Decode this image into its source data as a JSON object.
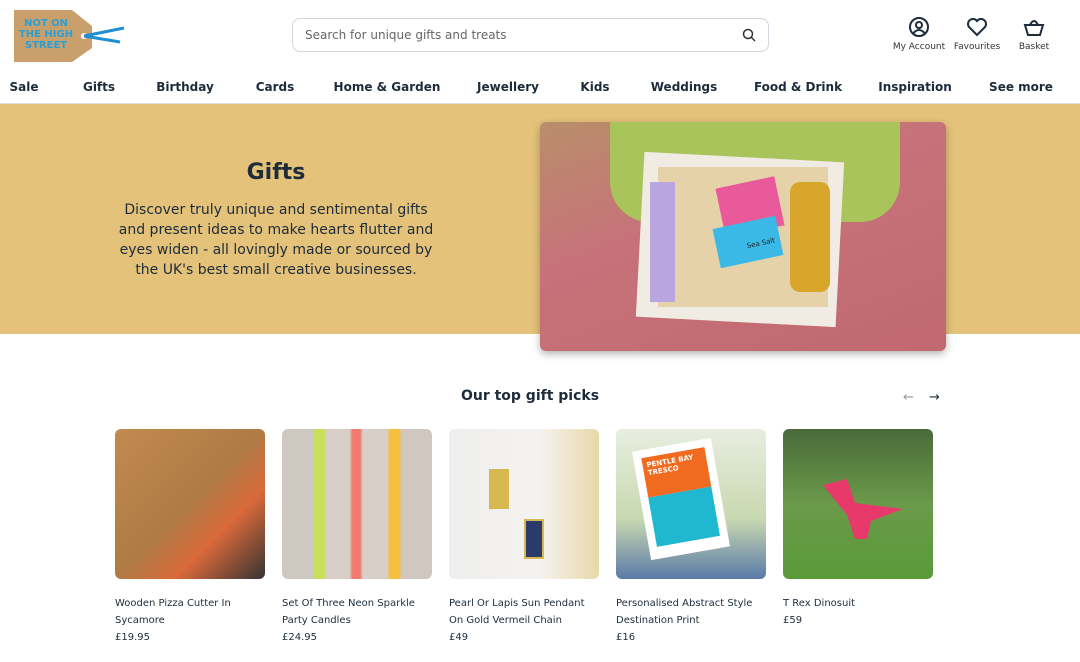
{
  "header": {
    "logo_text": "NOT ON THE HIGH STREET",
    "search_placeholder": "Search for unique gifts and treats",
    "icons": [
      {
        "label": "My Account",
        "icon": "account-icon"
      },
      {
        "label": "Favourites",
        "icon": "heart-icon"
      },
      {
        "label": "Basket",
        "icon": "basket-icon"
      }
    ]
  },
  "nav": [
    "Sale",
    "Gifts",
    "Birthday",
    "Cards",
    "Home & Garden",
    "Jewellery",
    "Kids",
    "Weddings",
    "Food & Drink",
    "Inspiration",
    "See more"
  ],
  "hero": {
    "title": "Gifts",
    "text": "Discover truly unique and sentimental gifts and present ideas to make hearts flutter and eyes widen - all lovingly made or sourced by the UK's best small creative businesses.",
    "bg_color": "#e4c27a",
    "image_label": "Sea Salt"
  },
  "picks": {
    "title": "Our top gift picks",
    "products": [
      {
        "title": "Wooden Pizza Cutter In Sycamore",
        "price": "£19.95"
      },
      {
        "title": "Set Of Three Neon Sparkle Party Candles",
        "price": "£24.95"
      },
      {
        "title": "Pearl Or Lapis Sun Pendant On Gold Vermeil Chain",
        "price": "£49"
      },
      {
        "title": "Personalised Abstract Style Destination Print",
        "price": "£16",
        "image_label": "PENTLE BAY TRESCO"
      },
      {
        "title": "T Rex Dinosuit",
        "price": "£59"
      }
    ]
  }
}
